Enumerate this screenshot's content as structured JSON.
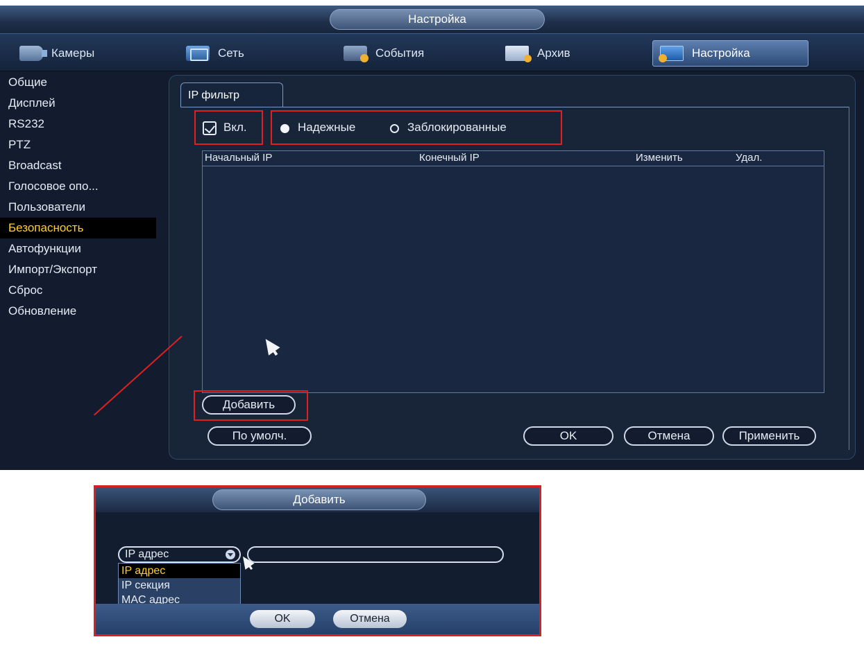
{
  "window": {
    "title": "Настройка"
  },
  "tabs": [
    {
      "label": "Камеры",
      "icon": "camera-icon"
    },
    {
      "label": "Сеть",
      "icon": "network-icon"
    },
    {
      "label": "События",
      "icon": "events-icon"
    },
    {
      "label": "Архив",
      "icon": "archive-icon"
    },
    {
      "label": "Настройка",
      "icon": "settings-icon",
      "active": true
    }
  ],
  "sidebar": {
    "items": [
      "Общие",
      "Дисплей",
      "RS232",
      "PTZ",
      "Broadcast",
      "Голосовое опо...",
      "Пользователи",
      "Безопасность",
      "Автофункции",
      "Импорт/Экспорт",
      "Сброс",
      "Обновление"
    ],
    "active": "Безопасность"
  },
  "ip_filter": {
    "tab_label": "IP фильтр",
    "enable_label": "Вкл.",
    "enabled": true,
    "mode_trusted": "Надежные",
    "mode_blocked": "Заблокированные",
    "mode_selected": "Надежные",
    "table_headers": [
      "Начальный IP",
      "Конечный IP",
      "Изменить",
      "Удал."
    ],
    "rows": []
  },
  "buttons": {
    "add": "Добавить",
    "default": "По умолч.",
    "ok": "OK",
    "cancel": "Отмена",
    "apply": "Применить"
  },
  "add_dialog": {
    "title": "Добавить",
    "type_selected": "IP адрес",
    "type_options": [
      "IP адрес",
      "IP секция",
      "MAC адрес"
    ],
    "ip_value": "",
    "ok": "OK",
    "cancel": "Отмена"
  },
  "colors": {
    "highlight_red": "#e02020",
    "active_text": "#ffd21c",
    "panel_bg": "#182438"
  }
}
